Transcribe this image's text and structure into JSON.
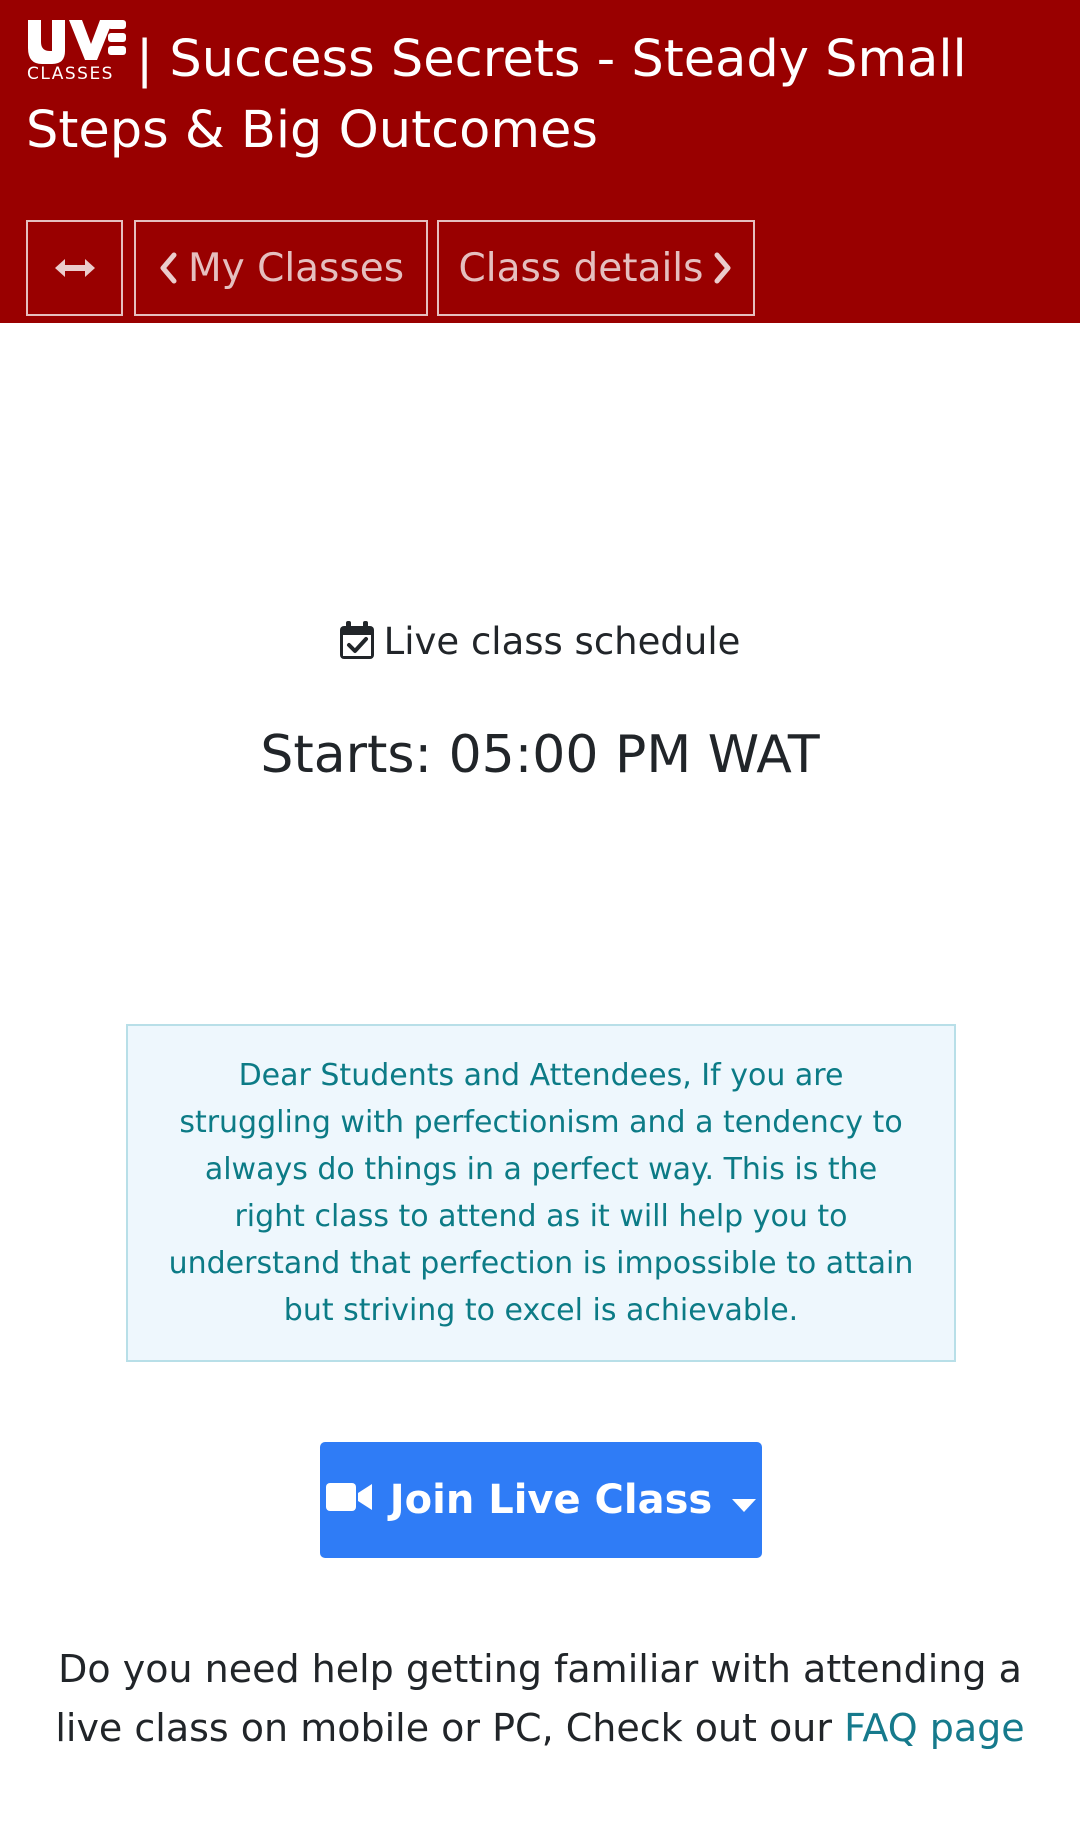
{
  "header": {
    "logo_label": "CLASSES",
    "separator": "|",
    "title": "Success Secrets - Steady Small Steps & Big Outcomes",
    "background_color": "#990000"
  },
  "nav": {
    "toggle_icon": "arrows-horizontal-icon",
    "my_classes_label": "My Classes",
    "class_details_label": "Class details"
  },
  "schedule": {
    "icon": "calendar-check-icon",
    "label": "Live class schedule",
    "starts": "Starts: 05:00 PM WAT"
  },
  "notice": {
    "text": "Dear Students and Attendees, If you are struggling with perfectionism and a tendency to always do things in a perfect way. This is the right class to attend as it will help you to understand that perfection is impossible to attain but striving to excel is achievable."
  },
  "join": {
    "label": "Join Live Class",
    "icon": "video-camera-icon",
    "button_color": "#2f7cf6"
  },
  "help": {
    "text": "Do you need help getting familiar with attending a live class on mobile or PC, Check out our ",
    "link_label": "FAQ page"
  }
}
